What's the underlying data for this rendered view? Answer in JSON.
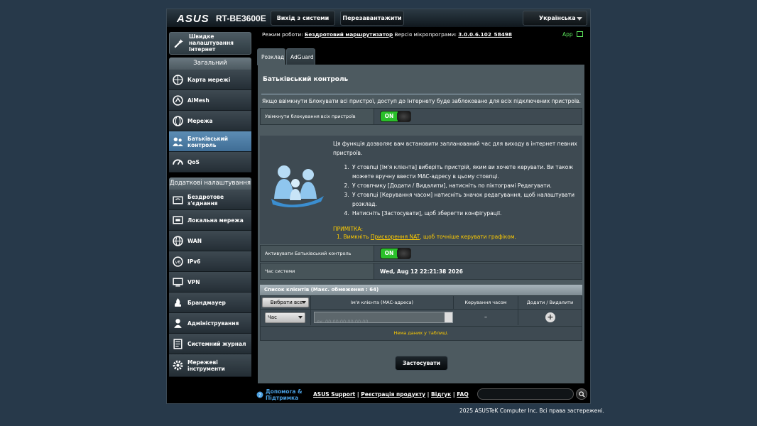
{
  "header": {
    "brand": "ASUS",
    "model": "RT-BE3600E",
    "logout_label": "Вихід з системи",
    "reboot_label": "Перезавантажити",
    "language": "Українська"
  },
  "status_bar": {
    "mode_label": "Режим роботи:",
    "mode_value": "Бездротовий маршрутизатор",
    "firmware_label": "Версія мікропрограми:",
    "firmware_value": "3.0.0.6.102_58498",
    "app_label": "App"
  },
  "sidebar": {
    "quick_setup": "Швидке налаштування Інтернет",
    "general_header": "Загальний",
    "general_items": [
      {
        "label": "Карта мережі"
      },
      {
        "label": "AiMesh"
      },
      {
        "label": "Мережа"
      },
      {
        "label": "Батьківський контроль"
      },
      {
        "label": "QoS"
      }
    ],
    "advanced_header": "Додаткові налаштування",
    "advanced_items": [
      {
        "label": "Бездротове з'єднання"
      },
      {
        "label": "Локальна мережа"
      },
      {
        "label": "WAN"
      },
      {
        "label": "IPv6"
      },
      {
        "label": "VPN"
      },
      {
        "label": "Брандмауер"
      },
      {
        "label": "Адміністрування"
      },
      {
        "label": "Системний журнал"
      },
      {
        "label": "Мережеві інструменти"
      }
    ]
  },
  "tabs": [
    "Розклад",
    "AdGuard"
  ],
  "panel": {
    "title": "Батьківський контроль",
    "notice": "Якщо ввімкнути Блокувати всі пристрої, доступ до Інтернету буде заблоковано для всіх підключених пристроїв.",
    "block_all_label": "Увімкнути блокування всіх пристроїв",
    "toggle_on": "ON",
    "description": "Ця функція дозволяє вам встановити запланований час для виходу в інтернет певних пристроїв.",
    "steps": [
      "У стовпці [Ім'я клієнта] виберіть пристрій, яким ви хочете керувати. Ви також можете вручну ввести MAC-адресу в цьому стовпці.",
      "У стовпчику [Додати / Видалити], натисніть по піктограмі Редагувати.",
      "У стовпці [Керування часом] натисніть значок редагування, щоб налаштувати розклад.",
      "Натисніть [Застосувати], щоб зберегти конфігурації."
    ],
    "note_title": "ПРИМІТКА:",
    "note_prefix": "1. Вимкніть ",
    "note_link": "Прискорення NAT",
    "note_suffix": ", щоб точніше керувати графіком.",
    "enable_label": "Активувати Батьківський контроль",
    "system_time_label": "Час системи",
    "system_time_value": "Wed, Aug 12 22:21:38 2026",
    "client_list_title": "Список клієнтів (Макс. обмеження : 64)",
    "columns": {
      "select_all": "Вибрати все",
      "client_name": "Ім'я клієнта (MAC-адреса)",
      "time_mgmt": "Керування часом",
      "add_delete": "Додати / Видалити"
    },
    "row": {
      "type_select": "Час",
      "mac_placeholder": "ex: 00:00:00:00:00:00",
      "time_mgmt_value": "–"
    },
    "no_data": "Нема даних у таблиці.",
    "apply_label": "Застосувати"
  },
  "footer": {
    "help_label": "Допомога & Підтримка",
    "links": [
      "ASUS Support",
      "Реєстрація продукту",
      "Відгук",
      "FAQ"
    ],
    "separator": "|",
    "copyright": "2025 ASUSTeK Computer Inc. Всі права застережені."
  },
  "colors": {
    "active_nav": "#4f7fa8",
    "toggle_on": "#2ac02a",
    "note_text": "#ffcc00",
    "help_link": "#4a9fe0"
  }
}
